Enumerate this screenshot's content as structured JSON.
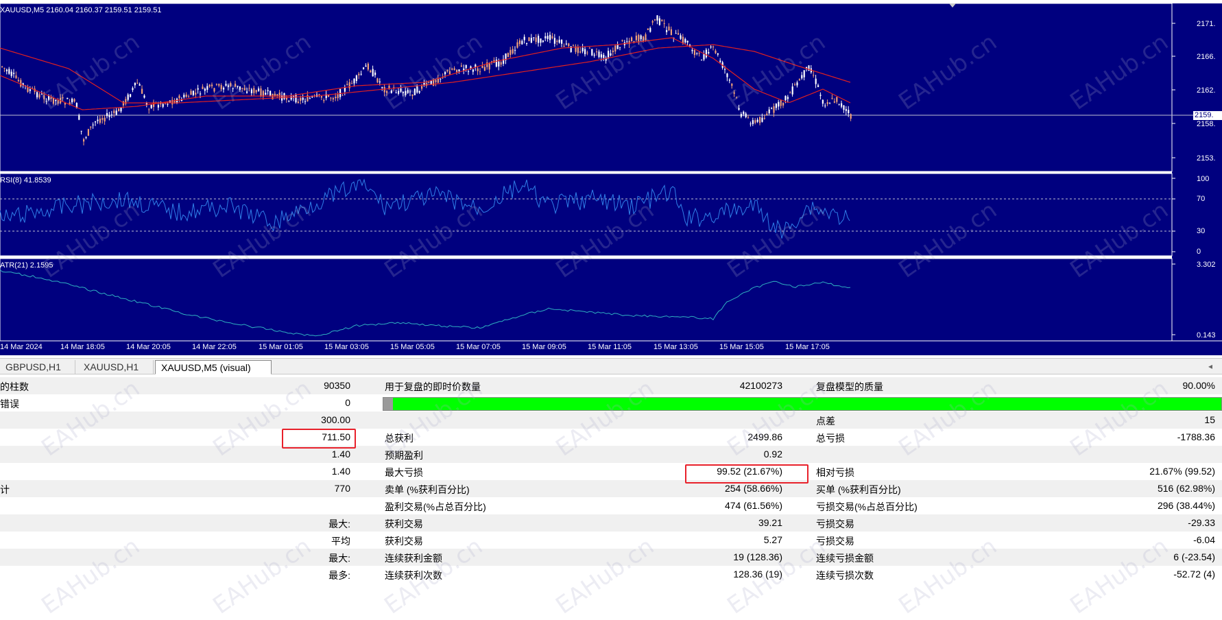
{
  "chart": {
    "price_title": "XAUUSD,M5  2160.04 2160.37 2159.51 2159.51",
    "rsi_title": "RSI(8) 41.8539",
    "atr_title": "ATR(21) 2.1595",
    "price_axis": [
      "2171.",
      "2166.",
      "2162.",
      "2158.",
      "2153."
    ],
    "price_tag": "2159.",
    "rsi_axis": [
      "100",
      "70",
      "30",
      "0"
    ],
    "atr_axis": [
      "3.302",
      "0.143"
    ],
    "time_axis": [
      "14 Mar 2024",
      "14 Mar 18:05",
      "14 Mar 20:05",
      "14 Mar 22:05",
      "15 Mar 01:05",
      "15 Mar 03:05",
      "15 Mar 05:05",
      "15 Mar 07:05",
      "15 Mar 09:05",
      "15 Mar 11:05",
      "15 Mar 13:05",
      "15 Mar 15:05",
      "15 Mar 17:05"
    ],
    "colors": {
      "background": "#00007f",
      "bull": "#ffffff",
      "bear": "#f0a078",
      "ma": "#e02020",
      "rsi": "#2f7fe8",
      "atr": "#2fb0c0"
    }
  },
  "tabs": [
    {
      "label": "GBPUSD,H1",
      "active": false
    },
    {
      "label": "XAUUSD,H1",
      "active": false
    },
    {
      "label": "XAUUSD,M5 (visual)",
      "active": true
    }
  ],
  "report": {
    "r0": {
      "c1": "的柱数",
      "v1": "90350",
      "c2": "用于复盘的即时价数量",
      "v2": "42100273",
      "c3": "复盘模型的质量",
      "v3": "90.00%"
    },
    "r1": {
      "c1": "错误",
      "v1": "0"
    },
    "r2": {
      "v1": "300.00",
      "c3": "点差",
      "v3": "15"
    },
    "r3": {
      "v1": "711.50",
      "c2": "总获利",
      "v2": "2499.86",
      "c3": "总亏损",
      "v3": "-1788.36"
    },
    "r4": {
      "v1": "1.40",
      "c2": "预期盈利",
      "v2": "0.92"
    },
    "r5": {
      "v1": "1.40",
      "c2": "最大亏损",
      "v2": "99.52 (21.67%)",
      "c3": "相对亏损",
      "v3": "21.67% (99.52)"
    },
    "r6": {
      "c1": "计",
      "v1": "770",
      "c2": "卖单 (%获利百分比)",
      "v2": "254 (58.66%)",
      "c3": "买单 (%获利百分比)",
      "v3": "516 (62.98%)"
    },
    "r7": {
      "c2": "盈利交易(%占总百分比)",
      "v2": "474 (61.56%)",
      "c3": "亏损交易(%占总百分比)",
      "v3": "296 (38.44%)"
    },
    "r8": {
      "v1": "最大:",
      "c2": "获利交易",
      "v2": "39.21",
      "c3": "亏损交易",
      "v3": "-29.33"
    },
    "r9": {
      "v1": "平均",
      "c2": "获利交易",
      "v2": "5.27",
      "c3": "亏损交易",
      "v3": "-6.04"
    },
    "r10": {
      "v1": "最大:",
      "c2": "连续获利金额",
      "v2": "19 (128.36)",
      "c3": "连续亏损金额",
      "v3": "6 (-23.54)"
    },
    "r11": {
      "v1": "最多:",
      "c2": "连续获利次数",
      "v2": "128.36 (19)",
      "c3": "连续亏损次数",
      "v3": "-52.72 (4)"
    }
  },
  "watermark": "EAHub.cn"
}
